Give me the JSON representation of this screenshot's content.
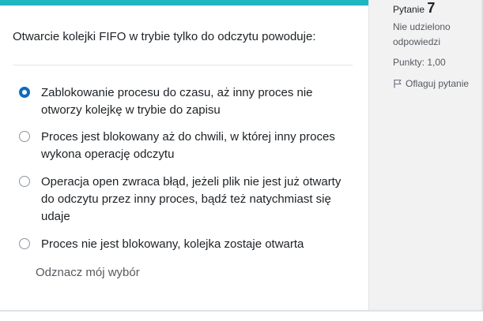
{
  "info": {
    "question_label": "Pytanie",
    "question_number": "7",
    "state": "Nie udzielono odpowiedzi",
    "grade": "Punkty: 1,00",
    "flag_label": "Oflaguj pytanie"
  },
  "question": {
    "text": "Otwarcie kolejki FIFO w trybie tylko do odczytu powoduje:",
    "answers": [
      {
        "label": "Zablokowanie procesu do czasu, aż inny proces nie otworzy kolejkę w trybie do zapisu",
        "selected": true
      },
      {
        "label": "Proces jest blokowany aż do chwili, w której inny proces wykona operację odczytu",
        "selected": false
      },
      {
        "label": "Operacja open zwraca błąd, jeżeli plik nie jest już otwarty do odczytu przez inny proces, bądź też natychmiast się udaje",
        "selected": false
      },
      {
        "label": "Proces nie jest blokowany, kolejka zostaje otwarta",
        "selected": false
      }
    ],
    "clear_label": "Odznacz mój wybór"
  },
  "colors": {
    "accent_bar": "#1fb6c1",
    "radio_selected": "#0f6cbf",
    "sidebar_bg": "#f2f2f3"
  }
}
